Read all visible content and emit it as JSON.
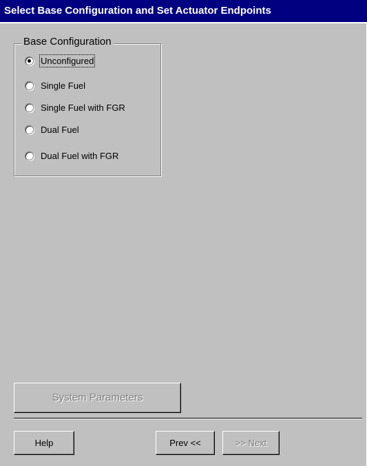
{
  "window": {
    "title": "Select Base Configuration and Set Actuator Endpoints"
  },
  "base_configuration": {
    "legend": "Base Configuration",
    "selected": "Unconfigured",
    "options": [
      {
        "label": "Unconfigured",
        "checked": true
      },
      {
        "label": "Single Fuel",
        "checked": false
      },
      {
        "label": "Single Fuel with FGR",
        "checked": false
      },
      {
        "label": "Dual Fuel",
        "checked": false
      },
      {
        "label": "Dual Fuel with FGR",
        "checked": false
      }
    ]
  },
  "buttons": {
    "system_parameters": "System Parameters",
    "help": "Help",
    "prev": "Prev <<",
    "next": ">> Next"
  },
  "colors": {
    "titlebar": "#000080",
    "face": "#c0c0c0",
    "disabled_text": "#808080"
  }
}
